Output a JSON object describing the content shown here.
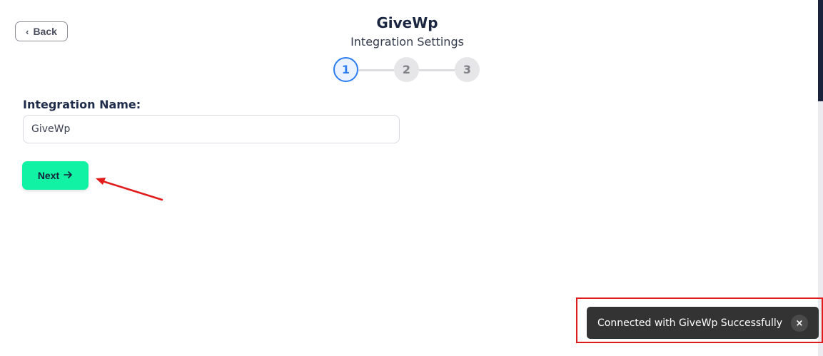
{
  "header": {
    "back_label": "Back",
    "title": "GiveWp",
    "subtitle": "Integration Settings"
  },
  "stepper": {
    "steps": [
      "1",
      "2",
      "3"
    ],
    "active_step": 1,
    "active_color": "#2d7cf0"
  },
  "form": {
    "name_label": "Integration Name:",
    "name_value": "GiveWp",
    "next_label": "Next"
  },
  "toast": {
    "message": "Connected with GiveWp Successfully",
    "close_icon": "×"
  },
  "colors": {
    "accent_button": "#11f2a4",
    "toast_bg": "#333333",
    "annotation": "#e11b1b"
  }
}
